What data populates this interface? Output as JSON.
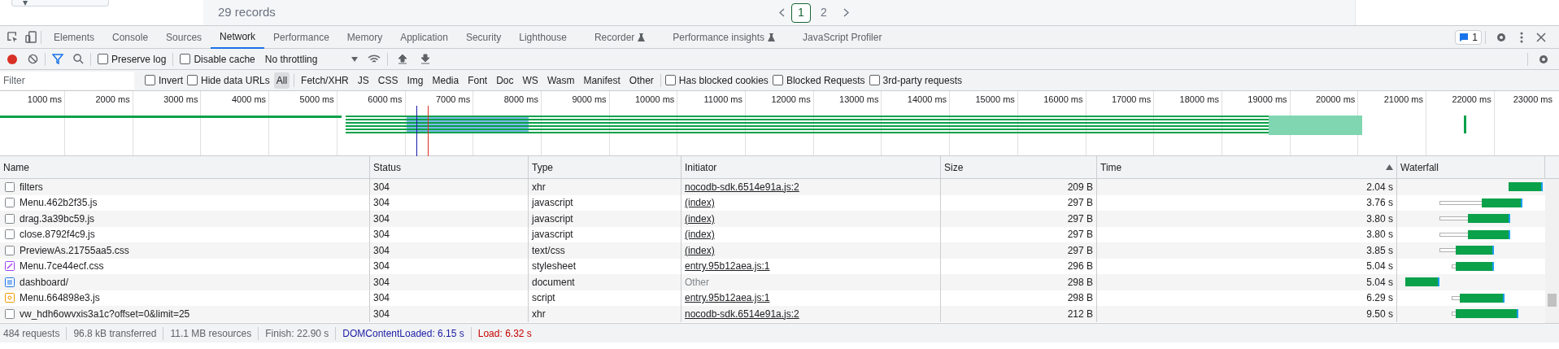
{
  "page": {
    "records": "29 records",
    "pages": [
      {
        "label": "1",
        "selected": true
      },
      {
        "label": "2",
        "selected": false
      }
    ]
  },
  "tabs": [
    {
      "label": "Elements",
      "selected": false,
      "experimental": false
    },
    {
      "label": "Console",
      "selected": false,
      "experimental": false
    },
    {
      "label": "Sources",
      "selected": false,
      "experimental": false
    },
    {
      "label": "Network",
      "selected": true,
      "experimental": false
    },
    {
      "label": "Performance",
      "selected": false,
      "experimental": false
    },
    {
      "label": "Memory",
      "selected": false,
      "experimental": false
    },
    {
      "label": "Application",
      "selected": false,
      "experimental": false
    },
    {
      "label": "Security",
      "selected": false,
      "experimental": false
    },
    {
      "label": "Lighthouse",
      "selected": false,
      "experimental": false
    },
    {
      "label": "Recorder",
      "selected": false,
      "experimental": true
    },
    {
      "label": "Performance insights",
      "selected": false,
      "experimental": true
    },
    {
      "label": "JavaScript Profiler",
      "selected": false,
      "experimental": false
    }
  ],
  "issues_badge": "1",
  "toolbar": {
    "recording": true,
    "preserve_log": {
      "label": "Preserve log",
      "checked": false
    },
    "disable_cache": {
      "label": "Disable cache",
      "checked": false
    },
    "throttling": "No throttling"
  },
  "filter_bar": {
    "placeholder": "Filter",
    "invert": {
      "label": "Invert",
      "checked": false
    },
    "hide_data_urls": {
      "label": "Hide data URLs",
      "checked": false
    },
    "types": [
      {
        "label": "All",
        "selected": true
      },
      {
        "label": "Fetch/XHR",
        "selected": false
      },
      {
        "label": "JS",
        "selected": false
      },
      {
        "label": "CSS",
        "selected": false
      },
      {
        "label": "Img",
        "selected": false
      },
      {
        "label": "Media",
        "selected": false
      },
      {
        "label": "Font",
        "selected": false
      },
      {
        "label": "Doc",
        "selected": false
      },
      {
        "label": "WS",
        "selected": false
      },
      {
        "label": "Wasm",
        "selected": false
      },
      {
        "label": "Manifest",
        "selected": false
      },
      {
        "label": "Other",
        "selected": false
      }
    ],
    "options": [
      {
        "label": "Has blocked cookies",
        "checked": false
      },
      {
        "label": "Blocked Requests",
        "checked": false
      },
      {
        "label": "3rd-party requests",
        "checked": false
      }
    ]
  },
  "timeline": {
    "ticks": [
      "1000 ms",
      "2000 ms",
      "3000 ms",
      "4000 ms",
      "5000 ms",
      "6000 ms",
      "7000 ms",
      "8000 ms",
      "9000 ms",
      "10000 ms",
      "11000 ms",
      "12000 ms",
      "13000 ms",
      "14000 ms",
      "15000 ms",
      "16000 ms",
      "17000 ms",
      "18000 ms",
      "19000 ms",
      "20000 ms",
      "21000 ms",
      "22000 ms",
      "23000 ms"
    ]
  },
  "table": {
    "columns": [
      "Name",
      "Status",
      "Type",
      "Initiator",
      "Size",
      "Time",
      "Waterfall"
    ],
    "rows": [
      {
        "name": "filters",
        "kind": "plain",
        "status": "304",
        "type": "xhr",
        "initiator": "nocodb-sdk.6514e91a.js:2",
        "initiator_link": true,
        "size": "209 B",
        "time": "2.04 s"
      },
      {
        "name": "Menu.462b2f35.js",
        "kind": "plain",
        "status": "304",
        "type": "javascript",
        "initiator": "(index)",
        "initiator_link": true,
        "size": "297 B",
        "time": "3.76 s"
      },
      {
        "name": "drag.3a39bc59.js",
        "kind": "plain",
        "status": "304",
        "type": "javascript",
        "initiator": "(index)",
        "initiator_link": true,
        "size": "297 B",
        "time": "3.80 s"
      },
      {
        "name": "close.8792f4c9.js",
        "kind": "plain",
        "status": "304",
        "type": "javascript",
        "initiator": "(index)",
        "initiator_link": true,
        "size": "297 B",
        "time": "3.80 s"
      },
      {
        "name": "PreviewAs.21755aa5.css",
        "kind": "plain",
        "status": "304",
        "type": "text/css",
        "initiator": "(index)",
        "initiator_link": true,
        "size": "297 B",
        "time": "3.85 s"
      },
      {
        "name": "Menu.7ce44ecf.css",
        "kind": "stylesheet",
        "status": "304",
        "type": "stylesheet",
        "initiator": "entry.95b12aea.js:1",
        "initiator_link": true,
        "size": "296 B",
        "time": "5.04 s"
      },
      {
        "name": "dashboard/",
        "kind": "document",
        "status": "304",
        "type": "document",
        "initiator": "Other",
        "initiator_link": false,
        "size": "298 B",
        "time": "5.04 s"
      },
      {
        "name": "Menu.664898e3.js",
        "kind": "script",
        "status": "304",
        "type": "script",
        "initiator": "entry.95b12aea.js:1",
        "initiator_link": true,
        "size": "298 B",
        "time": "6.29 s"
      },
      {
        "name": "vw_hdh6owvxis3a1c?offset=0&limit=25",
        "kind": "plain",
        "status": "304",
        "type": "xhr",
        "initiator": "nocodb-sdk.6514e91a.js:2",
        "initiator_link": true,
        "size": "212 B",
        "time": "9.50 s"
      }
    ]
  },
  "status_bar": [
    {
      "text": "484 requests",
      "kind": "plain"
    },
    {
      "text": "96.8 kB transferred",
      "kind": "plain"
    },
    {
      "text": "11.1 MB resources",
      "kind": "plain"
    },
    {
      "text": "Finish: 22.90 s",
      "kind": "plain"
    },
    {
      "text": "DOMContentLoaded: 6.15 s",
      "kind": "domcontent"
    },
    {
      "text": "Load: 6.32 s",
      "kind": "load"
    }
  ]
}
